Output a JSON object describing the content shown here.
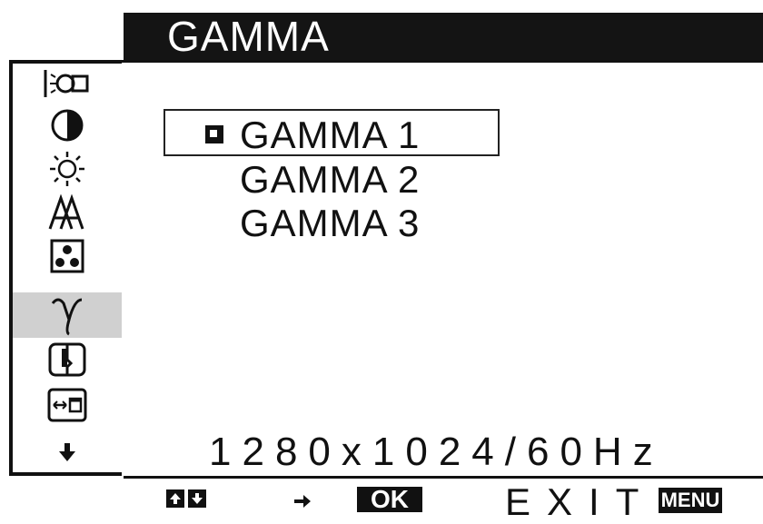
{
  "header": {
    "title": "GAMMA"
  },
  "sidebar": {
    "icons": [
      "backlight-icon",
      "contrast-icon",
      "brightness-icon",
      "sharpness-icon",
      "color-icon",
      "gamma-icon",
      "zoom-icon",
      "position-icon",
      "scroll-down-icon"
    ],
    "selected": "gamma-icon"
  },
  "gamma_menu": {
    "options": [
      "GAMMA 1",
      "GAMMA 2",
      "GAMMA 3"
    ],
    "selected": "GAMMA 1"
  },
  "status": {
    "resolution": "1280x1024/60Hz"
  },
  "footer": {
    "ok_label": "OK",
    "exit_label": "EXIT",
    "menu_label": "MENU"
  },
  "colors": {
    "bar": "#141414",
    "selection_highlight": "#d0d0d0"
  }
}
